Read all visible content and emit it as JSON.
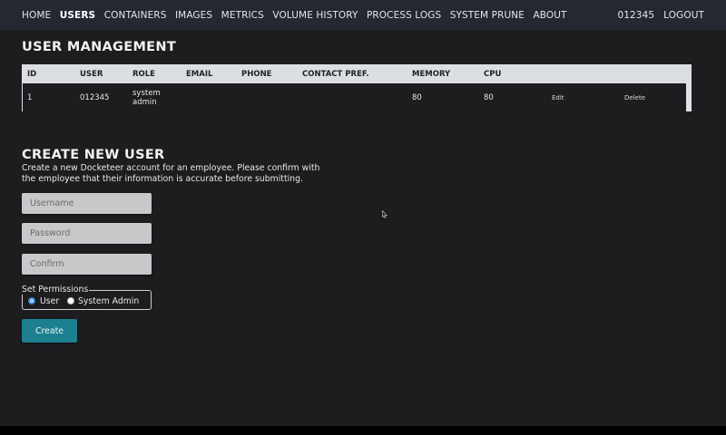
{
  "nav": {
    "items": [
      "HOME",
      "USERS",
      "CONTAINERS",
      "IMAGES",
      "METRICS",
      "VOLUME HISTORY",
      "PROCESS LOGS",
      "SYSTEM PRUNE",
      "ABOUT"
    ],
    "active": "USERS",
    "username": "012345",
    "logout": "LOGOUT"
  },
  "user_management": {
    "title": "USER MANAGEMENT",
    "columns": [
      "ID",
      "USER",
      "ROLE",
      "EMAIL",
      "PHONE",
      "CONTACT PREF.",
      "MEMORY",
      "CPU"
    ],
    "rows": [
      {
        "id": "1",
        "user": "012345",
        "role_line1": "system",
        "role_line2": "admin",
        "email": "",
        "phone": "",
        "contact_pref": "",
        "memory": "80",
        "cpu": "80",
        "edit": "Edit",
        "delete": "Delete"
      }
    ]
  },
  "create_user": {
    "title": "CREATE NEW USER",
    "description": "Create a new Docketeer account for an employee. Please confirm with the employee that their information is accurate before submitting.",
    "username_placeholder": "Username",
    "password_placeholder": "Password",
    "confirm_placeholder": "Confirm",
    "permissions_legend": "Set Permissions",
    "permission_user": "User",
    "permission_admin": "System Admin",
    "selected_permission": "User",
    "create_label": "Create"
  },
  "colors": {
    "navbar": "#232831",
    "background": "#1d1c1f",
    "button": "#1d8090",
    "radio_selected": "#2f7fd8"
  }
}
